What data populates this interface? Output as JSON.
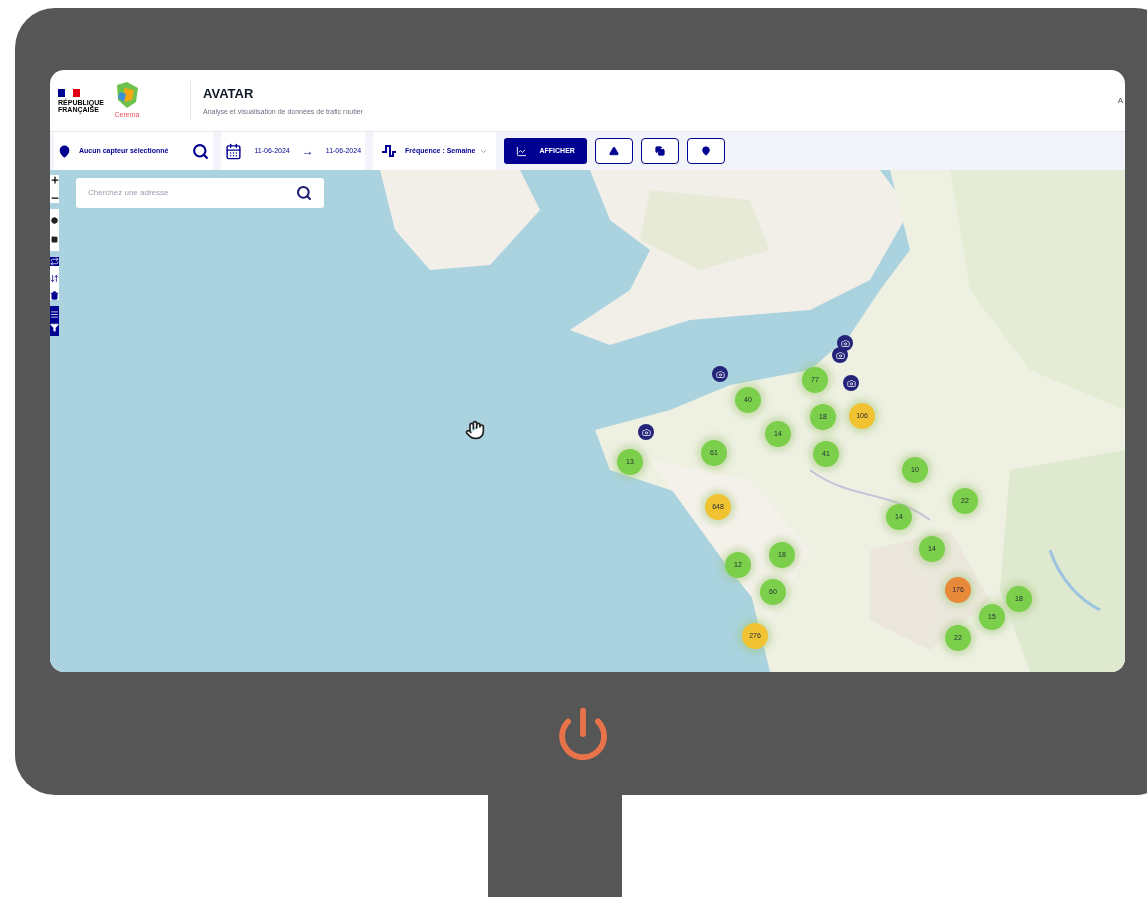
{
  "header": {
    "logo_lines": [
      "RÉPUBLIQUE",
      "FRANÇAISE"
    ],
    "partner_logo_text": "Cerema",
    "title": "AVATAR",
    "subtitle": "Analyse et visualisation de données de trafic routier",
    "right_text": "A"
  },
  "toolbar": {
    "sensor": "Aucun capteur sélectionné",
    "date_from": "11-06-2024",
    "arrow": "→",
    "date_to": "11-06-2024",
    "frequency": "Fréquence : Semaine",
    "show_button": "AFFICHER",
    "icon_buttons": [
      {
        "kind": "triangle"
      },
      {
        "kind": "copy"
      },
      {
        "kind": "pin"
      }
    ]
  },
  "map": {
    "search": {
      "placeholder": "Cherchez une adresse"
    },
    "clusters": [
      {
        "count": "77",
        "color": "#7ccf4a"
      },
      {
        "count": "40",
        "color": "#7ccf4a"
      },
      {
        "count": "18",
        "color": "#7ccf4a"
      },
      {
        "count": "106",
        "color": "#f1c232"
      },
      {
        "count": "14",
        "color": "#7ccf4a"
      },
      {
        "count": "41",
        "color": "#7ccf4a"
      },
      {
        "count": "61",
        "color": "#7ccf4a"
      },
      {
        "count": "13",
        "color": "#7ccf4a"
      },
      {
        "count": "10",
        "color": "#7ccf4a"
      },
      {
        "count": "22",
        "color": "#7ccf4a"
      },
      {
        "count": "648",
        "color": "#f1c232"
      },
      {
        "count": "14",
        "color": "#7ccf4a"
      },
      {
        "count": "14",
        "color": "#7ccf4a"
      },
      {
        "count": "18",
        "color": "#7ccf4a"
      },
      {
        "count": "12",
        "color": "#7ccf4a"
      },
      {
        "count": "60",
        "color": "#7ccf4a"
      },
      {
        "count": "176",
        "color": "#e8893a"
      },
      {
        "count": "18",
        "color": "#7ccf4a"
      },
      {
        "count": "15",
        "color": "#7ccf4a"
      },
      {
        "count": "276",
        "color": "#f1c232"
      },
      {
        "count": "22",
        "color": "#7ccf4a"
      }
    ]
  }
}
